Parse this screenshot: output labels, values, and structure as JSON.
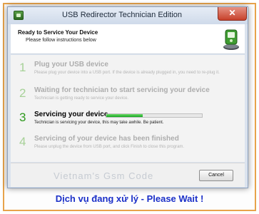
{
  "window": {
    "title": "USB Redirector Technician Edition",
    "close_symbol": "✕"
  },
  "header": {
    "title": "Ready to Service Your Device",
    "subtitle": "Please follow instructions below",
    "icon": "usb-service-icon"
  },
  "steps": [
    {
      "number": "1",
      "title": "Plug your USB device",
      "description": "Please plug your device into a USB port. If the device is already plugged in, you need to re-plug it."
    },
    {
      "number": "2",
      "title": "Waiting for technician to start servicing your device",
      "description": "Technician is getting ready to service your device."
    },
    {
      "number": "3",
      "title": "Servicing your device",
      "description": "Technician is servicing your device, this may take awhile. Be patient.",
      "progress": 0.38,
      "active": true
    },
    {
      "number": "4",
      "title": "Servicing of your device has been finished",
      "description": "Please unplug the device from USB port, and click Finish to close this program."
    }
  ],
  "footer": {
    "watermark": "Vietnam's Gsm Code",
    "cancel_label": "Cancel"
  },
  "caption": "Dịch vụ đang xử lý - Please Wait !",
  "colors": {
    "caption": "#1b30c8",
    "progress": "#14a521",
    "frame_border": "#e7a34b",
    "close_button": "#c7412b"
  }
}
